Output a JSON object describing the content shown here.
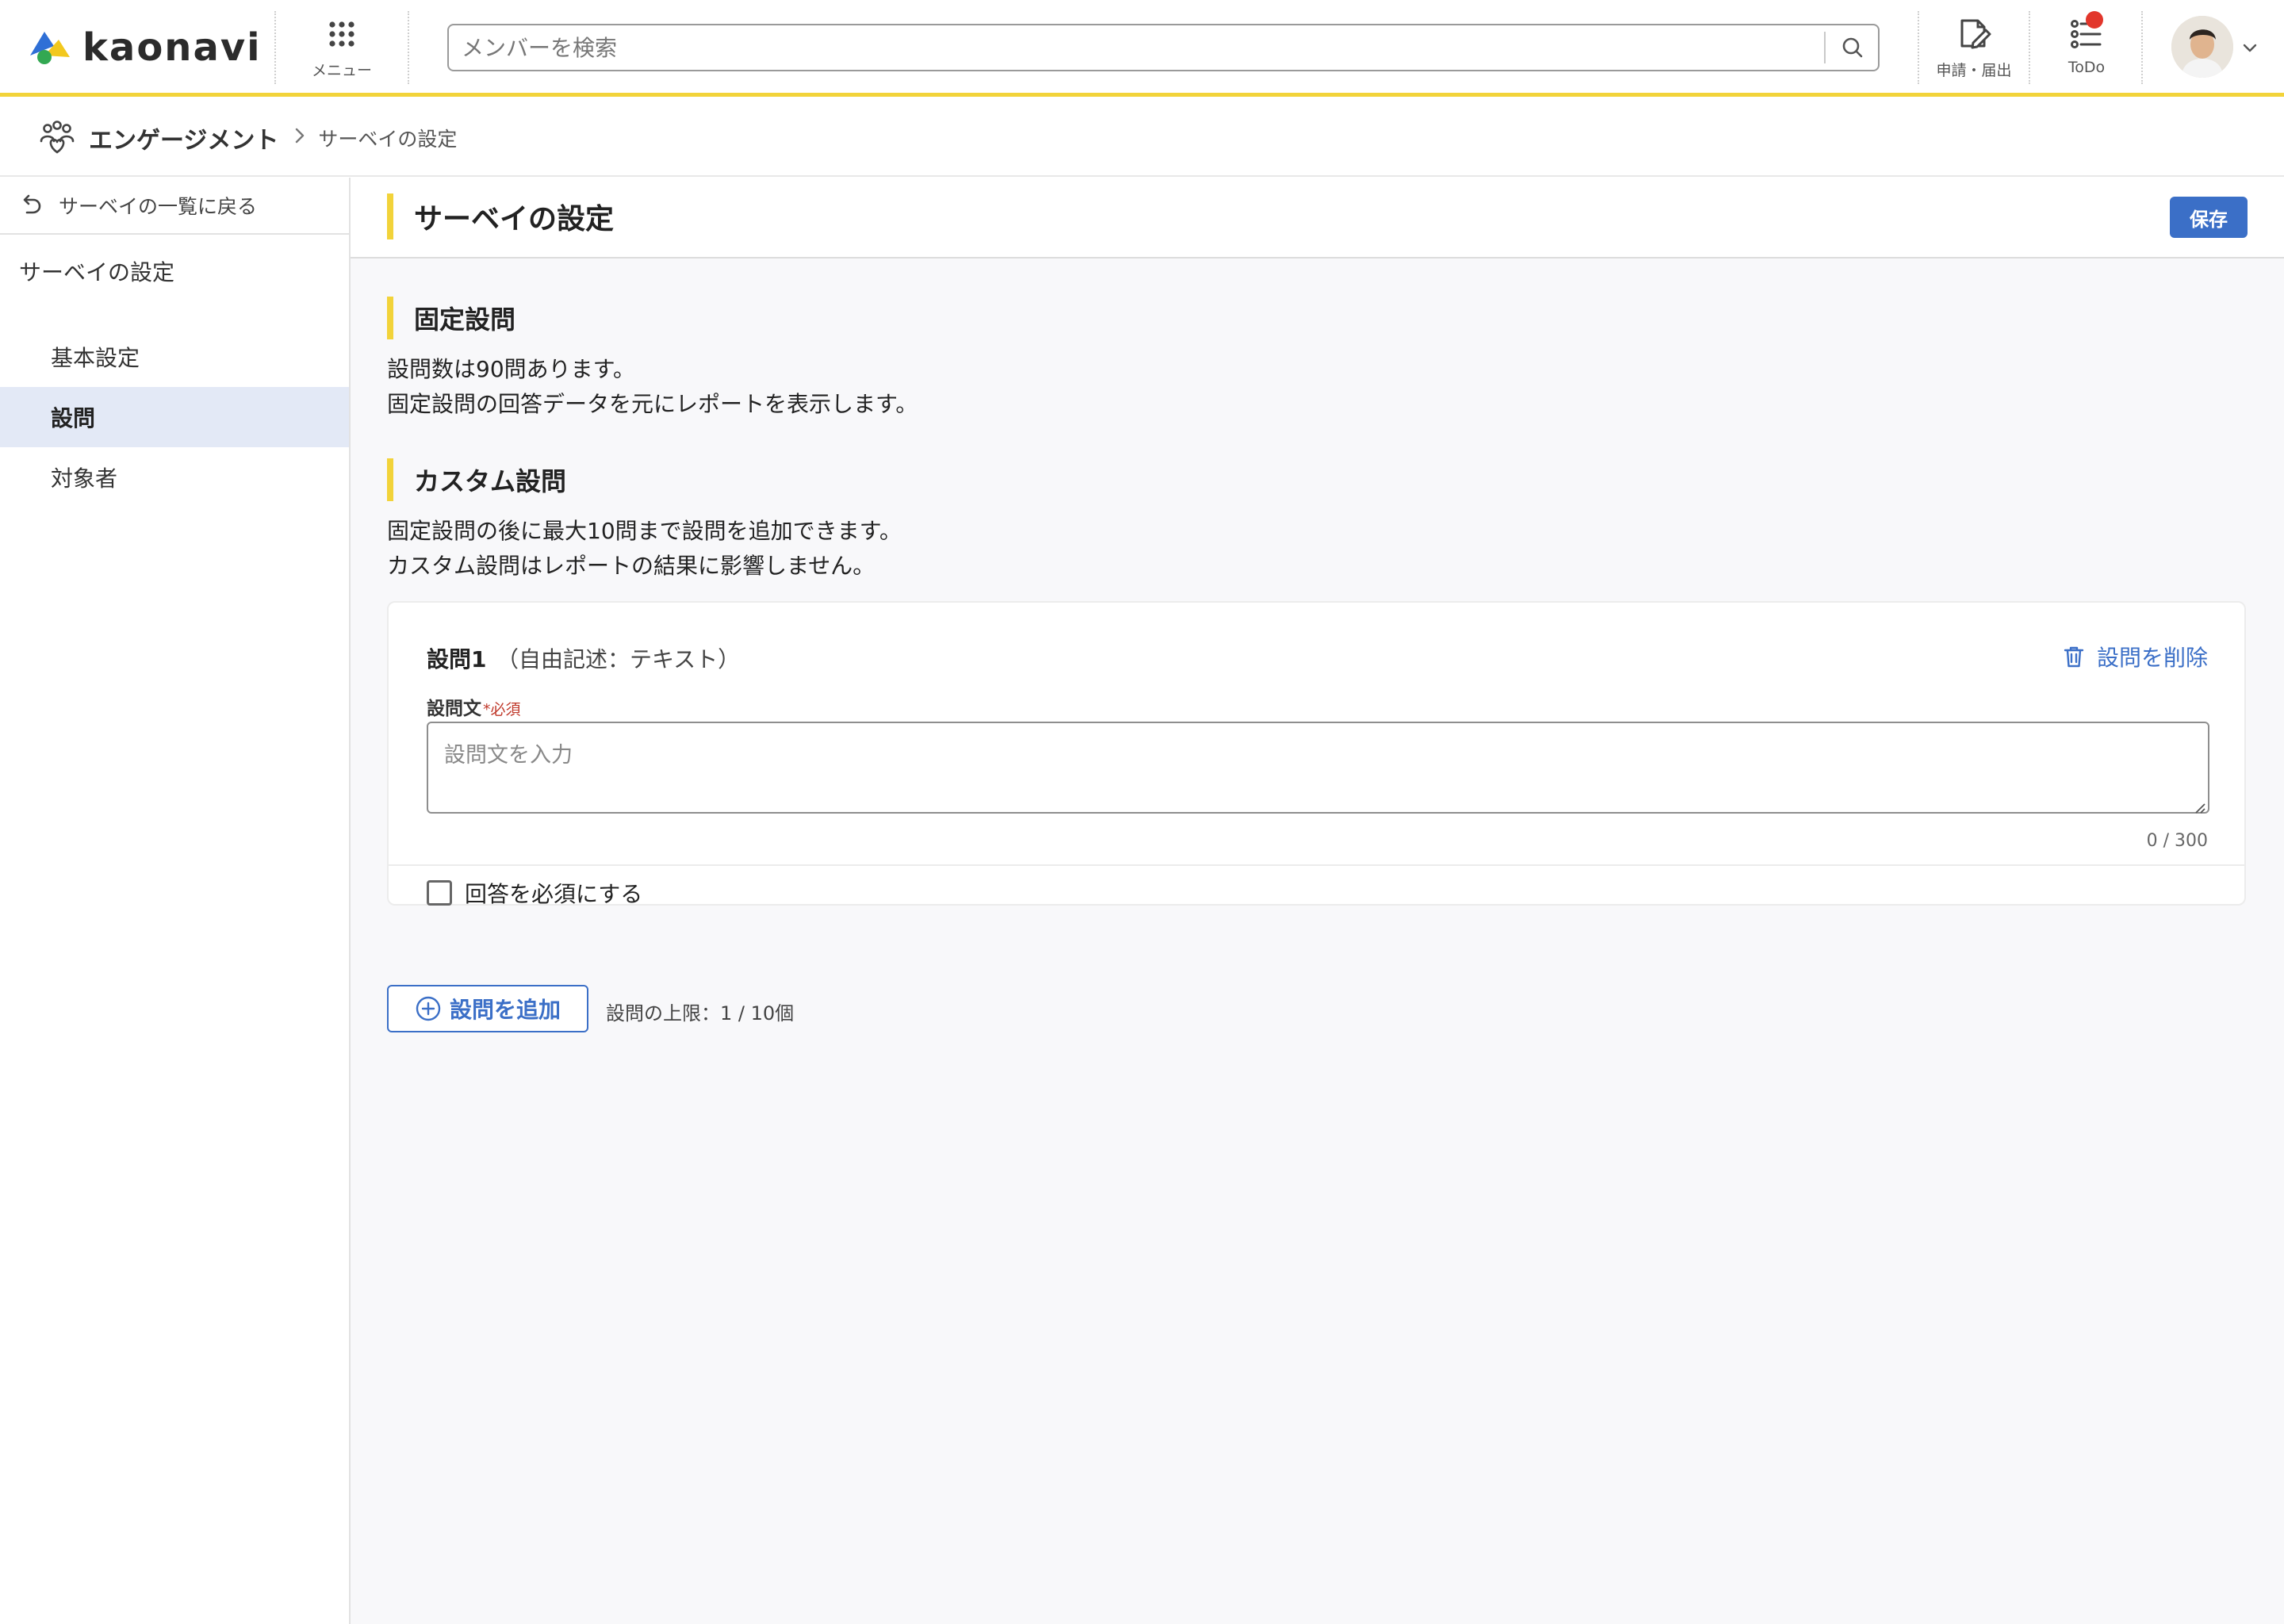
{
  "header": {
    "logo_text": "kaonavi",
    "menu_label": "メニュー",
    "search_placeholder": "メンバーを検索",
    "request_label": "申請・届出",
    "todo_label": "ToDo",
    "todo_has_notification": true
  },
  "breadcrumb": {
    "root": "エンゲージメント",
    "current": "サーベイの設定"
  },
  "sidebar": {
    "back_label": "サーベイの一覧に戻る",
    "group_label": "サーベイの設定",
    "items": [
      {
        "label": "基本設定",
        "active": false
      },
      {
        "label": "設問",
        "active": true
      },
      {
        "label": "対象者",
        "active": false
      }
    ]
  },
  "page": {
    "title": "サーベイの設定",
    "save_label": "保存"
  },
  "fixed_section": {
    "heading": "固定設問",
    "line1": "設問数は90問あります。",
    "line2": "固定設問の回答データを元にレポートを表示します。"
  },
  "custom_section": {
    "heading": "カスタム設問",
    "line1": "固定設問の後に最大10問まで設問を追加できます。",
    "line2": "カスタム設問はレポートの結果に影響しません。"
  },
  "question": {
    "title": "設問1",
    "type": "（自由記述：テキスト）",
    "delete_label": "設問を削除",
    "field_label": "設問文",
    "required_mark": "*必須",
    "placeholder": "設問文を入力",
    "value": "",
    "counter": "0 / 300",
    "required_toggle_label": "回答を必須にする",
    "required_checked": false
  },
  "add_question": {
    "label": "設問を追加",
    "limit_text": "設問の上限：1 / 10個"
  },
  "colors": {
    "accent_yellow": "#f2d33a",
    "primary_blue": "#3b6fc7",
    "notification_red": "#e2362b",
    "active_item_bg": "#e3e9f6"
  },
  "icons": {
    "menu": "grid-dots-icon",
    "search": "search-icon",
    "request": "document-pen-icon",
    "todo": "checklist-icon",
    "engagement": "people-heart-icon",
    "back": "undo-arrow-icon",
    "delete": "trash-icon",
    "add": "plus-circle-icon"
  }
}
